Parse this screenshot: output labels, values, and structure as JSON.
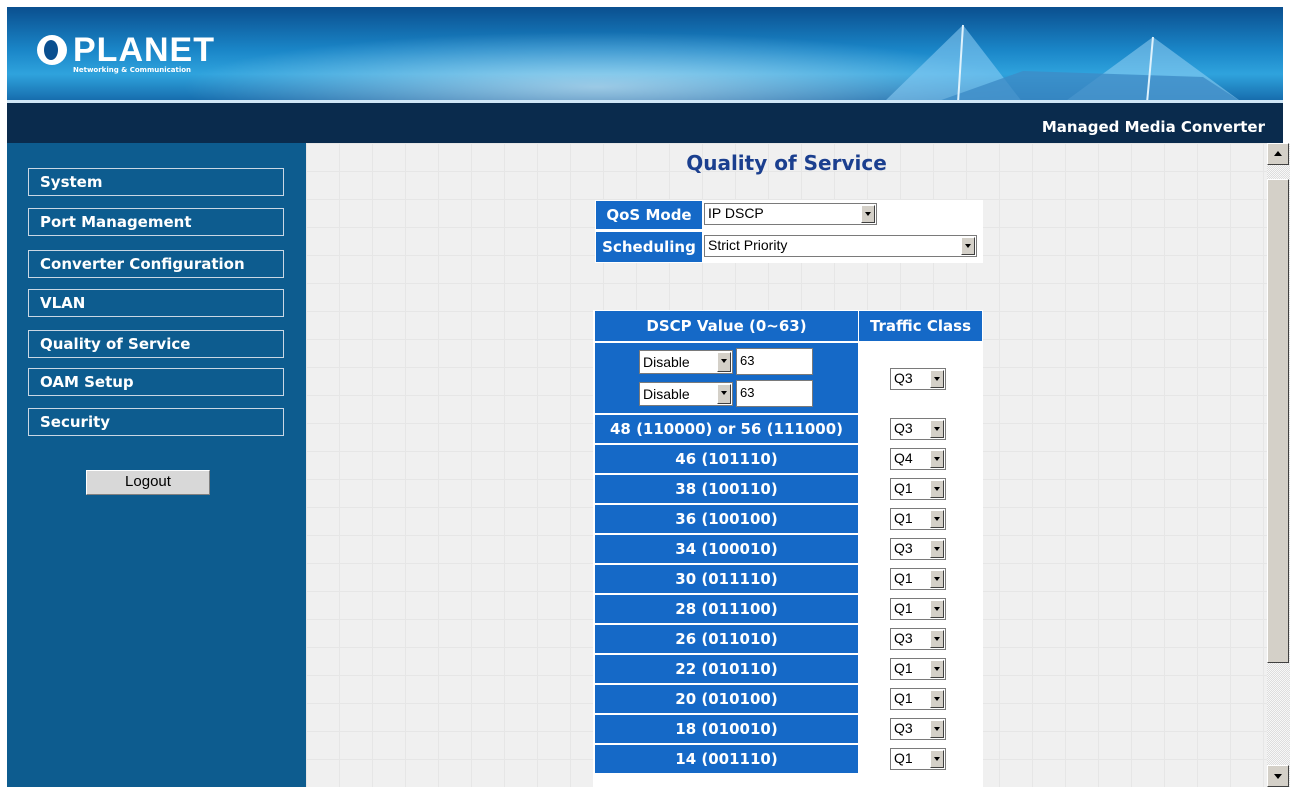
{
  "header": {
    "logo_name": "PLANET",
    "logo_tagline": "Networking & Communication",
    "product_name": "Managed Media Converter"
  },
  "sidebar": {
    "items": [
      {
        "label": "System"
      },
      {
        "label": "Port Management"
      },
      {
        "label": "Converter Configuration"
      },
      {
        "label": "VLAN"
      },
      {
        "label": "Quality of Service"
      },
      {
        "label": "OAM Setup"
      },
      {
        "label": "Security"
      }
    ],
    "logout_label": "Logout"
  },
  "main": {
    "title": "Quality of Service",
    "qos_mode_label": "QoS Mode",
    "qos_mode_value": "IP DSCP",
    "scheduling_label": "Scheduling",
    "scheduling_value": "Strict Priority",
    "table": {
      "col_dscp": "DSCP Value (0~63)",
      "col_class": "Traffic Class",
      "custom_rows": [
        {
          "mode": "Disable",
          "value": "63"
        },
        {
          "mode": "Disable",
          "value": "63"
        }
      ],
      "custom_class": "Q3",
      "rows": [
        {
          "dscp": "48 (110000) or 56 (111000)",
          "class": "Q3"
        },
        {
          "dscp": "46 (101110)",
          "class": "Q4"
        },
        {
          "dscp": "38 (100110)",
          "class": "Q1"
        },
        {
          "dscp": "36 (100100)",
          "class": "Q1"
        },
        {
          "dscp": "34 (100010)",
          "class": "Q3"
        },
        {
          "dscp": "30 (011110)",
          "class": "Q1"
        },
        {
          "dscp": "28 (011100)",
          "class": "Q1"
        },
        {
          "dscp": "26 (011010)",
          "class": "Q3"
        },
        {
          "dscp": "22 (010110)",
          "class": "Q1"
        },
        {
          "dscp": "20 (010100)",
          "class": "Q1"
        },
        {
          "dscp": "18 (010010)",
          "class": "Q3"
        },
        {
          "dscp": "14 (001110)",
          "class": "Q1"
        }
      ]
    }
  }
}
